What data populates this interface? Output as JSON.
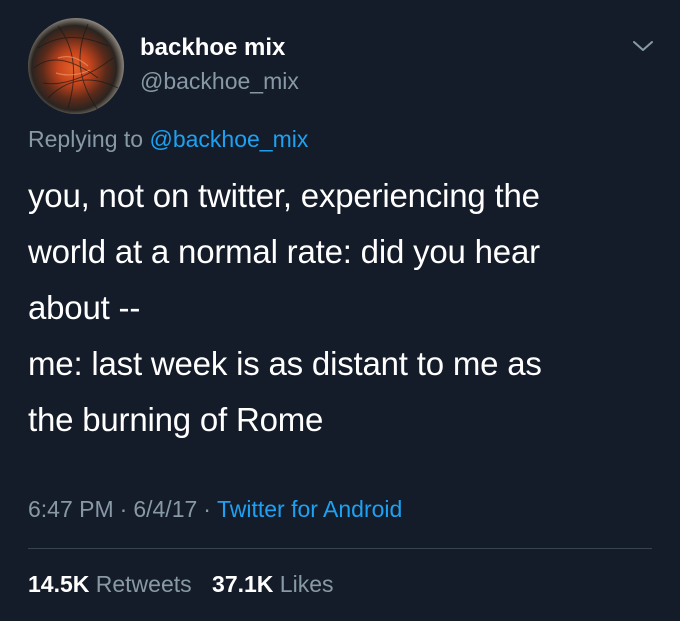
{
  "author": {
    "display_name": "backhoe mix",
    "handle": "@backhoe_mix",
    "avatar_icon": "profile-avatar"
  },
  "reply": {
    "prefix": "Replying to",
    "mention": "@backhoe_mix"
  },
  "tweet": {
    "lines": [
      "you, not on twitter, experiencing the",
      "world at a normal rate: did you hear",
      "about --",
      "me: last week is as distant to me as",
      "the burning of Rome"
    ]
  },
  "meta": {
    "time": "6:47 PM",
    "separator": "·",
    "date": "6/4/17",
    "client": "Twitter for Android"
  },
  "stats": {
    "retweets_count": "14.5K",
    "retweets_label": "Retweets",
    "likes_count": "37.1K",
    "likes_label": "Likes"
  },
  "colors": {
    "background": "#151c29",
    "text": "#ffffff",
    "secondary": "#8899a6",
    "link": "#1da1f2"
  },
  "icons": {
    "menu": "chevron-down-icon"
  }
}
